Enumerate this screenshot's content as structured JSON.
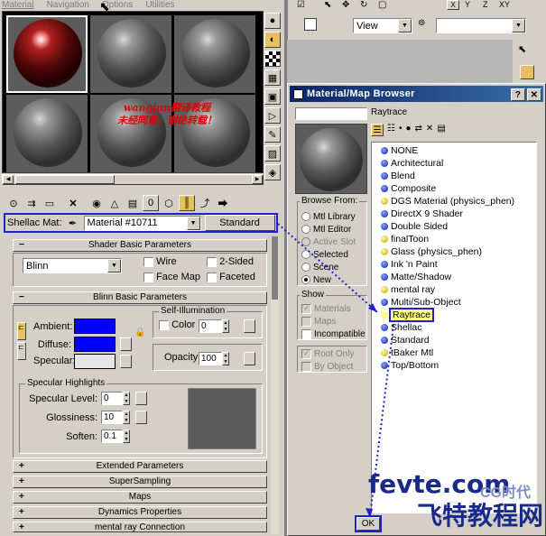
{
  "menu": [
    "Material",
    "Navigation",
    "Options",
    "Utilities"
  ],
  "watermark_cn": [
    "wangjun翻译教程",
    "未经同意，谢绝转载！"
  ],
  "slot_icons": [
    "sphere-type-icon",
    "backlight-icon",
    "background-icon",
    "uv-tiling-icon",
    "video-check-icon",
    "preview-icon",
    "options-icon",
    "select-by-material-icon",
    "navigator-icon"
  ],
  "toolbar_icons": [
    "get-material-icon",
    "put-to-scene-icon",
    "assign-to-selection-icon",
    "reset-icon",
    "make-copy-icon",
    "make-unique-icon",
    "put-to-library-icon",
    "material-id-icon",
    "show-map-icon",
    "show-end-result-icon",
    "go-to-parent-icon",
    "go-forward-icon"
  ],
  "material": {
    "label": "Shellac Mat:",
    "name": "Material #10711",
    "type_button": "Standard"
  },
  "shader_basic": {
    "title": "Shader Basic Parameters",
    "shader": "Blinn",
    "wire": "Wire",
    "two_sided": "2-Sided",
    "face_map": "Face Map",
    "faceted": "Faceted"
  },
  "blinn_basic": {
    "title": "Blinn Basic Parameters",
    "ambient": "Ambient:",
    "diffuse": "Diffuse:",
    "specular": "Specular:",
    "self_illum": "Self-Illumination",
    "color": "Color",
    "color_value": "0",
    "opacity": "Opacity:",
    "opacity_value": "100",
    "ambient_color": "#0000ff",
    "diffuse_color": "#0000ff",
    "specular_color": "#e6e6e6"
  },
  "specular_highlights": {
    "title": "Specular Highlights",
    "level": "Specular Level:",
    "level_value": "0",
    "glossiness": "Glossiness:",
    "glossiness_value": "10",
    "soften": "Soften:",
    "soften_value": "0.1"
  },
  "rollouts": [
    "Extended Parameters",
    "SuperSampling",
    "Maps",
    "Dynamics Properties",
    "mental ray Connection"
  ],
  "main_toolbar": {
    "view": "View"
  },
  "browser": {
    "title": "Material/Map Browser",
    "current": "Raytrace",
    "browse_from": "Browse From:",
    "sources": [
      "Mtl Library",
      "Mtl Editor",
      "Active Slot",
      "Selected",
      "Scene",
      "New"
    ],
    "show": "Show",
    "show_items": [
      "Materials",
      "Maps",
      "Incompatible"
    ],
    "root_only": "Root Only",
    "by_object": "By Object",
    "ok": "OK",
    "items": [
      {
        "name": "NONE",
        "color": "blue"
      },
      {
        "name": "Architectural",
        "color": "blue"
      },
      {
        "name": "Blend",
        "color": "blue"
      },
      {
        "name": "Composite",
        "color": "blue"
      },
      {
        "name": "DGS Material (physics_phen)",
        "color": "yellow"
      },
      {
        "name": "DirectX 9 Shader",
        "color": "blue"
      },
      {
        "name": "Double Sided",
        "color": "blue"
      },
      {
        "name": "finalToon",
        "color": "yellow"
      },
      {
        "name": "Glass (physics_phen)",
        "color": "yellow"
      },
      {
        "name": "Ink 'n Paint",
        "color": "blue"
      },
      {
        "name": "Matte/Shadow",
        "color": "blue"
      },
      {
        "name": "mental ray",
        "color": "yellow"
      },
      {
        "name": "Multi/Sub-Object",
        "color": "blue"
      },
      {
        "name": "Raytrace",
        "color": "blue"
      },
      {
        "name": "Shellac",
        "color": "blue"
      },
      {
        "name": "Standard",
        "color": "blue"
      },
      {
        "name": "tBaker Mtl",
        "color": "yellow"
      },
      {
        "name": "Top/Bottom",
        "color": "blue"
      }
    ]
  },
  "watermark_site": "fevte.com",
  "watermark_cn2": "飞特教程网",
  "watermark_brand": "CG时代"
}
